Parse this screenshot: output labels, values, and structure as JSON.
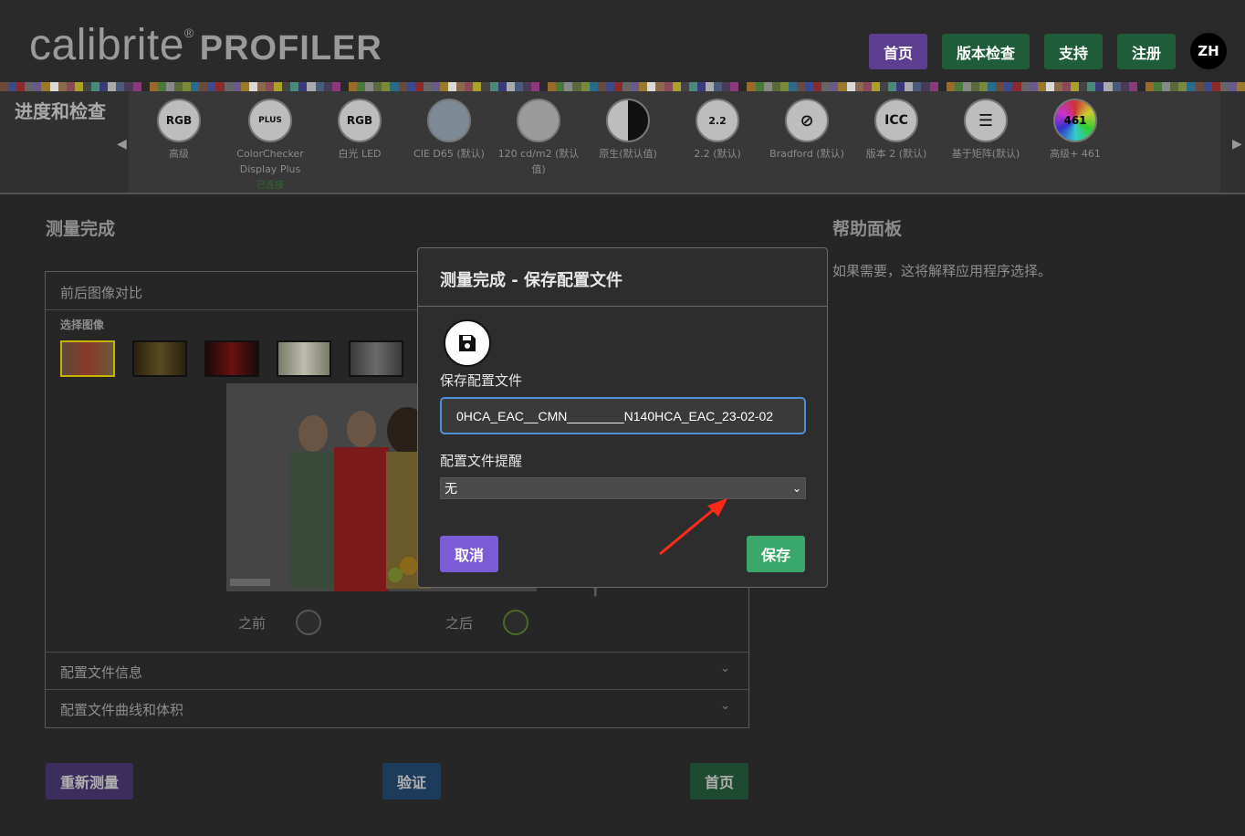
{
  "header": {
    "logo_brand": "calibrite",
    "logo_reg": "®",
    "logo_product": "PROFILER",
    "nav": [
      {
        "label": "首页",
        "color": "#5c3d8f"
      },
      {
        "label": "版本检查",
        "color": "#1f5c3a"
      },
      {
        "label": "支持",
        "color": "#1f5c3a"
      },
      {
        "label": "注册",
        "color": "#1f5c3a"
      }
    ],
    "avatar": "ZH"
  },
  "progress": {
    "title": "进度和检查",
    "steps": [
      {
        "icon": "RGB",
        "label": "高级",
        "sub": ""
      },
      {
        "icon": "PLUS",
        "label": "ColorChecker Display Plus",
        "sub": "已连接"
      },
      {
        "icon": "RGB",
        "label": "白光 LED",
        "sub": ""
      },
      {
        "icon": "",
        "label": "CIE D65 (默认)",
        "sub": ""
      },
      {
        "icon": "",
        "label": "120 cd/m2 (默认值)",
        "sub": ""
      },
      {
        "icon": "",
        "label": "原生(默认值)",
        "sub": ""
      },
      {
        "icon": "2.2",
        "label": "2.2 (默认)",
        "sub": ""
      },
      {
        "icon": "",
        "label": "Bradford (默认)",
        "sub": ""
      },
      {
        "icon": "ICC",
        "label": "版本 2 (默认)",
        "sub": ""
      },
      {
        "icon": "",
        "label": "基于矩阵(默认)",
        "sub": ""
      },
      {
        "icon": "461",
        "label": "高级+ 461",
        "sub": ""
      }
    ]
  },
  "main": {
    "title": "测量完成",
    "panel_title": "前后图像对比",
    "select_image": "选择图像",
    "before": "之前",
    "after": "之后",
    "accordion1": "配置文件信息",
    "accordion2": "配置文件曲线和体积"
  },
  "help": {
    "title": "帮助面板",
    "text": "如果需要，这将解释应用程序选择。"
  },
  "bottom_buttons": {
    "remeasure": "重新测量",
    "validate": "验证",
    "home": "首页"
  },
  "modal": {
    "title": "测量完成 - 保存配置文件",
    "save_profile_label": "保存配置文件",
    "profile_name": "0HCA_EAC__CMN________N140HCA_EAC_23-02-02",
    "reminder_label": "配置文件提醒",
    "reminder_value": "无",
    "cancel": "取消",
    "save": "保存"
  },
  "colors": {
    "purple": "#7b5bd6",
    "green": "#3aa86a",
    "focus_blue": "#4f8fd8"
  }
}
